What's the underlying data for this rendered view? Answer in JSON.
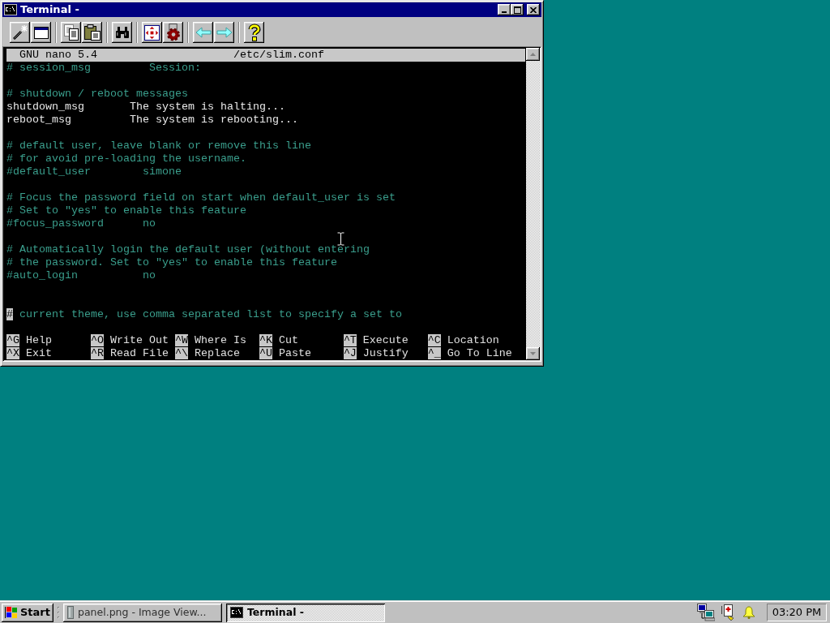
{
  "window": {
    "title": "Terminal -"
  },
  "editor": {
    "header": {
      "app": "GNU nano 5.4",
      "file": "/etc/slim.conf"
    },
    "lines": [
      {
        "kind": "comment",
        "text": "# session_msg         Session:"
      },
      {
        "kind": "blank"
      },
      {
        "kind": "comment",
        "text": "# shutdown / reboot messages"
      },
      {
        "kind": "setting",
        "text": "shutdown_msg       The system is halting..."
      },
      {
        "kind": "setting",
        "text": "reboot_msg         The system is rebooting..."
      },
      {
        "kind": "blank"
      },
      {
        "kind": "comment",
        "text": "# default user, leave blank or remove this line"
      },
      {
        "kind": "comment",
        "text": "# for avoid pre-loading the username."
      },
      {
        "kind": "comment",
        "text": "#default_user        simone"
      },
      {
        "kind": "blank"
      },
      {
        "kind": "comment",
        "text": "# Focus the password field on start when default_user is set"
      },
      {
        "kind": "comment",
        "text": "# Set to \"yes\" to enable this feature"
      },
      {
        "kind": "comment",
        "text": "#focus_password      no"
      },
      {
        "kind": "blank"
      },
      {
        "kind": "comment",
        "text": "# Automatically login the default user (without entering"
      },
      {
        "kind": "comment",
        "text": "# the password. Set to \"yes\" to enable this feature"
      },
      {
        "kind": "comment",
        "text": "#auto_login          no"
      },
      {
        "kind": "blank"
      },
      {
        "kind": "blank"
      },
      {
        "kind": "comment",
        "text": "# current theme, use comma separated list to specify a set to",
        "cursor": true
      }
    ],
    "shortcuts": [
      {
        "key": "^G",
        "label": "Help"
      },
      {
        "key": "^O",
        "label": "Write Out"
      },
      {
        "key": "^W",
        "label": "Where Is"
      },
      {
        "key": "^K",
        "label": "Cut"
      },
      {
        "key": "^T",
        "label": "Execute"
      },
      {
        "key": "^C",
        "label": "Location"
      },
      {
        "key": "^X",
        "label": "Exit"
      },
      {
        "key": "^R",
        "label": "Read File"
      },
      {
        "key": "^\\",
        "label": "Replace"
      },
      {
        "key": "^U",
        "label": "Paste"
      },
      {
        "key": "^J",
        "label": "Justify"
      },
      {
        "key": "^_",
        "label": "Go To Line"
      }
    ]
  },
  "taskbar": {
    "start": "Start",
    "tasks": [
      {
        "kind": "image-viewer",
        "label": "panel.png - Image View...",
        "selected": false
      },
      {
        "kind": "terminal",
        "label": "Terminal -",
        "selected": true
      }
    ],
    "clock": "03:20 PM"
  }
}
